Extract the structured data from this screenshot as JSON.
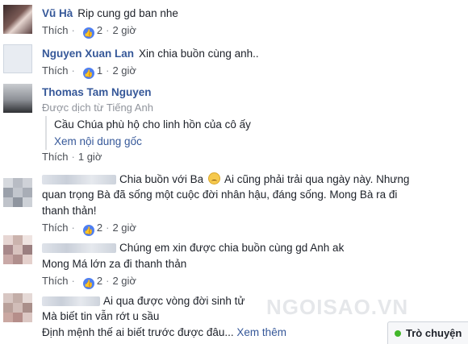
{
  "comments": [
    {
      "author": "Vũ Hà",
      "text": "Rip cung gd ban nhe",
      "like_label": "Thích",
      "reaction_count": "2",
      "time": "2 giờ"
    },
    {
      "author": "Nguyen Xuan Lan",
      "text": "Xin chia buồn cùng anh..",
      "like_label": "Thích",
      "reaction_count": "1",
      "time": "2 giờ"
    },
    {
      "author": "Thomas Tam Nguyen",
      "translated_from": "Được dịch từ Tiếng Anh",
      "translation": "Cầu Chúa phù hộ cho linh hồn của cô ấy",
      "see_original": "Xem nội dung gốc",
      "like_label": "Thích",
      "time": "1 giờ"
    },
    {
      "lines": [
        "Chia buồn với Ba",
        "Ai cũng phải trải qua ngày này. Nhưng",
        "quan trọng Bà đã sống một cuộc đời nhân hậu, đáng sống. Mong Bà ra đi",
        "thanh thản!"
      ],
      "like_label": "Thích",
      "reaction_count": "2",
      "time": "2 giờ"
    },
    {
      "lines": [
        "Chúng em xin được chia buồn cùng gd Anh ak",
        "Mong Má lớn za đi thanh thản"
      ],
      "like_label": "Thích",
      "reaction_count": "2",
      "time": "2 giờ"
    },
    {
      "lines": [
        "Ai qua được vòng đời sinh tử",
        "Mà biết tin vẫn rớt u sầu",
        "Định mệnh thế ai biết trước được đâu..."
      ],
      "see_more": "Xem thêm"
    }
  ],
  "watermark": "NGOISAO.VN",
  "chat_tab": {
    "label": "Trò chuyện"
  },
  "colors": {
    "author": "#365899",
    "meta": "#4b4f56",
    "like_badge": "#4f7ff0",
    "online": "#42b72a"
  }
}
